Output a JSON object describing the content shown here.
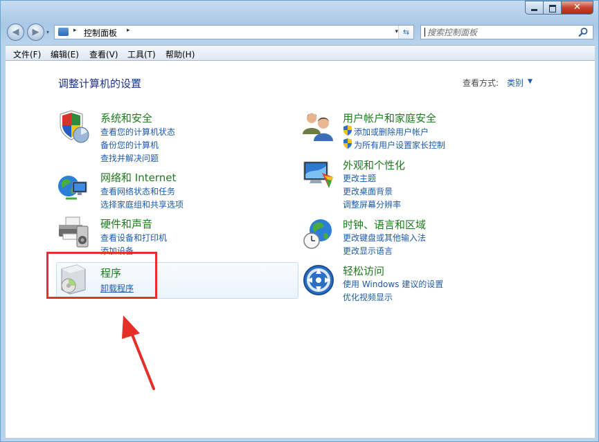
{
  "titlebar": {
    "close_glyph": "✕"
  },
  "nav": {
    "back_glyph": "◀",
    "forward_glyph": "▶",
    "recent_glyph": "▾",
    "address": {
      "icon": "control-panel-icon",
      "separator": "▸",
      "path": "控制面板",
      "trail": "▸",
      "dropdown": "▾",
      "refresh_glyph": "⇆"
    },
    "search": {
      "placeholder": "搜索控制面板",
      "value": ""
    }
  },
  "menu": [
    "文件(F)",
    "编辑(E)",
    "查看(V)",
    "工具(T)",
    "帮助(H)"
  ],
  "page": {
    "title": "调整计算机的设置",
    "view_label": "查看方式:",
    "view_value": "类别",
    "view_chev": "▼"
  },
  "categories": [
    {
      "title": "系统和安全",
      "icon": "shield-computer-icon",
      "tasks": [
        "查看您的计算机状态",
        "备份您的计算机",
        "查找并解决问题"
      ]
    },
    {
      "title": "网络和 Internet",
      "icon": "globe-network-icon",
      "tasks": [
        "查看网络状态和任务",
        "选择家庭组和共享选项"
      ]
    },
    {
      "title": "硬件和声音",
      "icon": "printer-speaker-icon",
      "tasks": [
        "查看设备和打印机",
        "添加设备"
      ]
    },
    {
      "title": "程序",
      "icon": "programs-disc-icon",
      "tasks": [
        "卸载程序"
      ]
    },
    {
      "title": "用户帐户和家庭安全",
      "icon": "users-icon",
      "tasks": [
        "添加或删除用户帐户",
        "为所有用户设置家长控制"
      ]
    },
    {
      "title": "外观和个性化",
      "icon": "monitor-palette-icon",
      "tasks": [
        "更改主题",
        "更改桌面背景",
        "调整屏幕分辨率"
      ]
    },
    {
      "title": "时钟、语言和区域",
      "icon": "globe-clock-icon",
      "tasks": [
        "更改键盘或其他输入法",
        "更改显示语言"
      ]
    },
    {
      "title": "轻松访问",
      "icon": "ease-of-access-icon",
      "tasks": [
        "使用 Windows 建议的设置",
        "优化视频显示"
      ]
    }
  ],
  "colors": {
    "category_title": "#1d7a1d",
    "task_link": "#1e5aa8",
    "page_title": "#1e3287",
    "annotation": "#e5302a"
  }
}
